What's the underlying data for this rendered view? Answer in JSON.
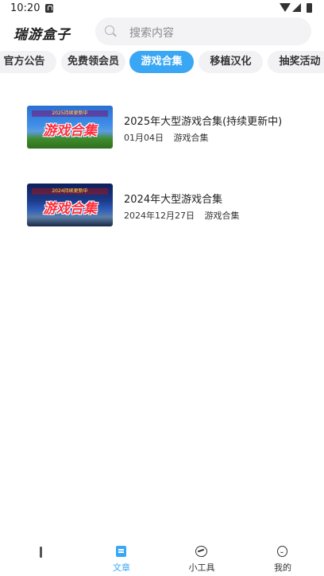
{
  "status_bar": {
    "time": "10:20"
  },
  "header": {
    "app_title": "瑞游盒子",
    "search_placeholder": "搜索内容"
  },
  "tabs": [
    {
      "label": "官方公告",
      "active": false
    },
    {
      "label": "免费领会员",
      "active": false
    },
    {
      "label": "游戏合集",
      "active": true
    },
    {
      "label": "移植汉化",
      "active": false
    },
    {
      "label": "抽奖活动",
      "active": false
    }
  ],
  "articles": [
    {
      "title": "2025年大型游戏合集(持续更新中)",
      "date": "01月04日",
      "category": "游戏合集",
      "thumb_banner": "2025持续更新中",
      "thumb_text": "游戏合集"
    },
    {
      "title": "2024年大型游戏合集",
      "date": "2024年12月27日",
      "category": "游戏合集",
      "thumb_banner": "2024持续更新中",
      "thumb_text": "游戏合集"
    }
  ],
  "bottom_nav": {
    "items": [
      {
        "label": "",
        "icon": "home-icon",
        "active": false
      },
      {
        "label": "文章",
        "icon": "article-icon",
        "active": true
      },
      {
        "label": "小工具",
        "icon": "tools-icon",
        "active": false
      },
      {
        "label": "我的",
        "icon": "profile-icon",
        "active": false
      }
    ]
  },
  "colors": {
    "accent": "#3aa7f5",
    "tab_bg": "#f2f2f4",
    "search_bg": "#f3f3f5"
  }
}
